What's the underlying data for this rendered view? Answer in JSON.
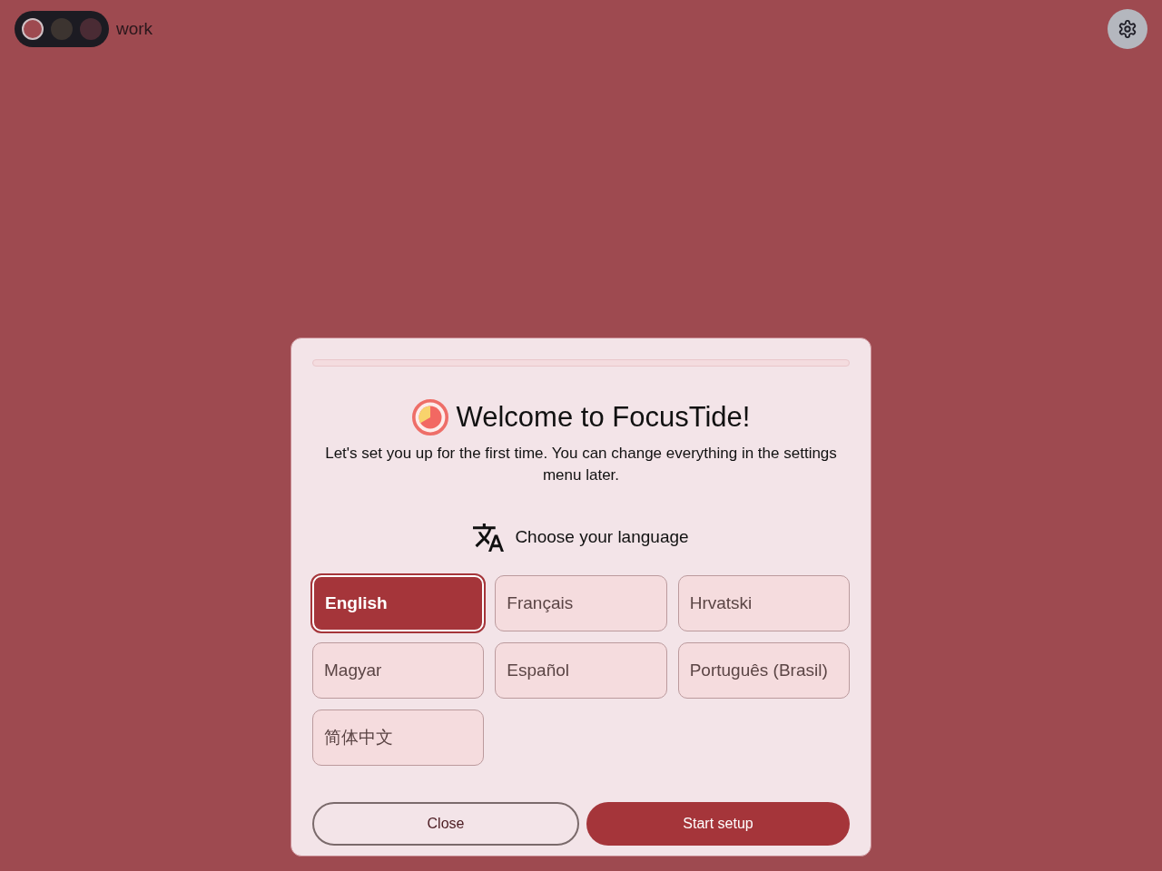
{
  "mode_switcher": {
    "modes": [
      {
        "selected": true,
        "color": "#9e4a50"
      },
      {
        "selected": false,
        "color": "#3c3430"
      },
      {
        "selected": false,
        "color": "#4a2b34"
      }
    ],
    "label": "work"
  },
  "dialog": {
    "progress": {
      "level": 0
    },
    "title": "Welcome to FocusTide!",
    "subtitle": "Let's set you up for the first time. You can change everything in the settings menu later.",
    "language_heading": "Choose your language",
    "languages": [
      {
        "label": "English",
        "selected": true
      },
      {
        "label": "Français",
        "selected": false
      },
      {
        "label": "Hrvatski",
        "selected": false
      },
      {
        "label": "Magyar",
        "selected": false
      },
      {
        "label": "Español",
        "selected": false
      },
      {
        "label": "Português (Brasil)",
        "selected": false
      },
      {
        "label": "简体中文",
        "selected": false
      }
    ],
    "buttons": [
      {
        "label": "Close",
        "kind": "secondary"
      },
      {
        "label": "Start setup",
        "kind": "primary"
      }
    ]
  }
}
